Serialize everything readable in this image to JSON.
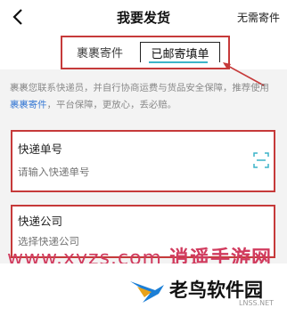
{
  "header": {
    "title": "我要发货",
    "right_action": "无需寄件"
  },
  "tabs": [
    {
      "label": "裹裹寄件",
      "active": false
    },
    {
      "label": "已邮寄填单",
      "active": true
    }
  ],
  "notice": {
    "text_before": "裹裹您联系快递员，并自行协商运费与货品安全保障，推荐使用",
    "link": "裹裹寄件",
    "text_after": "，平台保障，更放心，丢必赔。"
  },
  "tracking_field": {
    "label": "快递单号",
    "placeholder": "请输入快递单号"
  },
  "courier_field": {
    "label": "快递公司",
    "placeholder": "选择快递公司"
  },
  "watermark_site": {
    "url": "www.xyzs.com",
    "name": "逍遥手游网"
  },
  "watermark_logo": {
    "name": "老鸟软件园",
    "sub": "LNSS.NET"
  },
  "colors": {
    "accent": "#3cb4c8",
    "highlight_box": "#c63a3a",
    "link": "#3a7bd5",
    "watermark": "#d13b5e"
  }
}
